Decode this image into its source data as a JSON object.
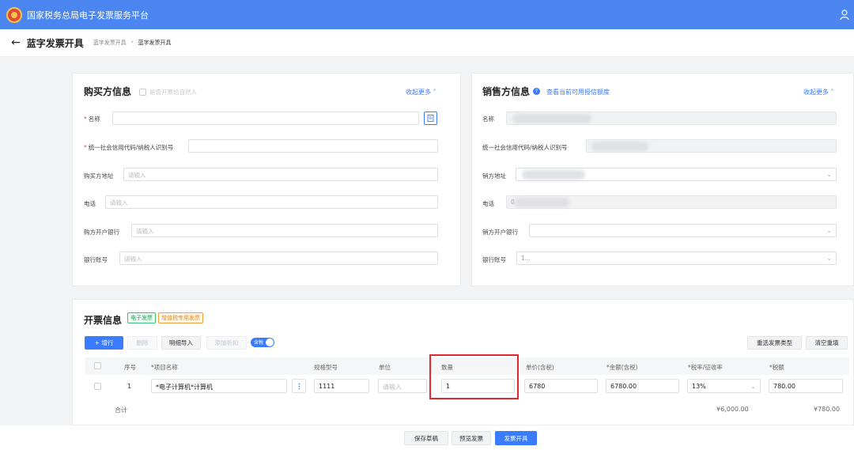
{
  "app": {
    "title": "国家税务总局电子发票服务平台"
  },
  "header": {
    "back": "←",
    "title": "蓝字发票开具",
    "breadcrumb": [
      "蓝字发票开具",
      "›",
      "蓝字发票开具"
    ]
  },
  "buyer": {
    "title": "购买方信息",
    "natural_person": "是否开票给自然人",
    "collapse": "收起更多",
    "fields": [
      {
        "label": "名称",
        "required": "*",
        "placeholder": ""
      },
      {
        "label": "统一社会信用代码/纳税人识别号",
        "required": "*",
        "placeholder": ""
      },
      {
        "label": "购买方地址",
        "placeholder": "请输入"
      },
      {
        "label": "电话",
        "placeholder": "请输入"
      },
      {
        "label": "购方开户银行",
        "placeholder": "请输入"
      },
      {
        "label": "银行账号",
        "placeholder": "请输入"
      }
    ]
  },
  "seller": {
    "title": "销售方信息",
    "quota_link": "查看当前可用授信额度",
    "collapse": "收起更多",
    "fields": [
      {
        "label": "名称"
      },
      {
        "label": "统一社会信用代码/纳税人识别号"
      },
      {
        "label": "销方地址"
      },
      {
        "label": "电话",
        "value": "0"
      },
      {
        "label": "销方开户银行"
      },
      {
        "label": "银行账号",
        "value": "1..."
      }
    ]
  },
  "invoice": {
    "title": "开票信息",
    "tag_electronic": "电子发票",
    "tag_type": "增值税专用发票",
    "buttons": {
      "add": "+ 增行",
      "delete": "删除",
      "import": "明细导入",
      "discount": "添加折扣",
      "tax_toggle": "含税",
      "reselect": "重选发票类型",
      "clear": "清空重填"
    },
    "columns": [
      "序号",
      "*项目名称",
      "规格型号",
      "单位",
      "数量",
      "单价(含税)",
      "*金额(含税)",
      "*税率/征收率",
      "*税额"
    ],
    "rows": [
      {
        "index": "1",
        "item": "*电子计算机*计算机",
        "spec": "1111",
        "unit_placeholder": "请输入",
        "qty": "1",
        "price": "6780",
        "amount": "6780.00",
        "rate": "13%",
        "tax": "780.00"
      }
    ],
    "total_label": "合计",
    "total_amount": "¥6,000.00",
    "total_tax": "¥780.00"
  },
  "footer": {
    "save": "保存草稿",
    "preview": "预览发票",
    "issue": "发票开具"
  },
  "colors": {
    "brand": "#4b86f0",
    "accent": "#3a7bff",
    "highlight": "#e0282e"
  },
  "icons": {
    "logo": "tax-emblem-icon",
    "user": "user-icon",
    "book": "address-book-icon",
    "info": "info-icon",
    "more": "more-dots-icon"
  }
}
